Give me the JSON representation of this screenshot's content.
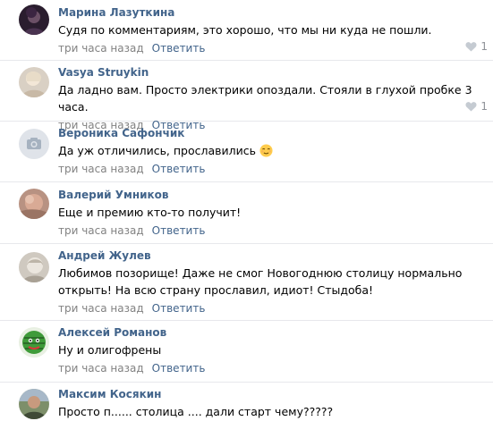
{
  "reply_label": "Ответить",
  "comments": [
    {
      "author": "Марина Лазуткина",
      "text": "Судя по комментариям, это хорошо, что мы ни куда не пошли.",
      "time": "три часа назад",
      "likes": "1",
      "avatar": "dark-portrait"
    },
    {
      "author": "Vasya Struykin",
      "text": "Да ладно вам. Просто электрики опоздали. Стояли в глухой пробке 3 часа.",
      "time": "три часа назад",
      "likes": "1",
      "avatar": "light-portrait"
    },
    {
      "author": "Вероника Сафончик",
      "text": "Да уж отличились, прославились",
      "time": "три часа назад",
      "avatar": "camera-placeholder",
      "emoji": "relieved-face"
    },
    {
      "author": "Валерий Умников",
      "text": "Еще и премию кто-то получит!",
      "time": "три часа назад",
      "avatar": "pink-portrait"
    },
    {
      "author": "Андрей Жулев",
      "text": "Любимов позорище! Даже не смог Новогоднюю столицу нормально\nоткрыть! На всю страну прославил, идиот! Стыдоба!",
      "time": "три часа назад",
      "avatar": "pale-portrait"
    },
    {
      "author": "Алексей Романов",
      "text": "Ну и олигофрены",
      "time": "три часа назад",
      "avatar": "watermelon-avatar"
    },
    {
      "author": "Максим Косякин",
      "text": "Просто п...... столица .... дали старт чему?????",
      "time": "",
      "avatar": "outdoor-portrait"
    }
  ],
  "colors": {
    "author_link": "#42648b",
    "meta_text": "#828282",
    "divider": "#e7e8ec",
    "like_icon": "#c5cbd2"
  }
}
